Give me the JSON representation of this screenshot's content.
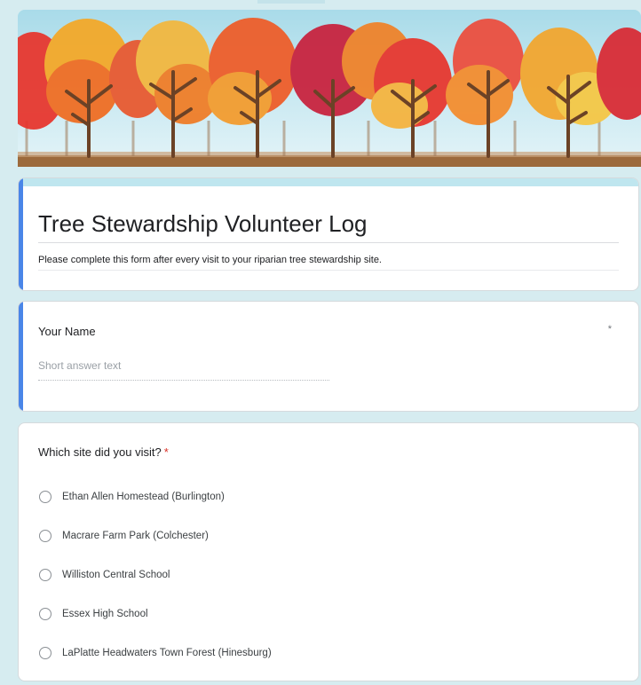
{
  "form": {
    "title": "Tree Stewardship Volunteer Log",
    "description": "Please complete this form after every visit to your riparian tree stewardship site."
  },
  "questions": {
    "name": {
      "label": "Your Name",
      "required_marker": "*",
      "placeholder": "Short answer text"
    },
    "site": {
      "label": "Which site did you visit?",
      "required_marker": "*",
      "options": [
        "Ethan Allen Homestead (Burlington)",
        "Macrare Farm Park (Colchester)",
        "Williston Central School",
        "Essex High School",
        "LaPlatte Headwaters Town Forest (Hinesburg)"
      ]
    }
  },
  "colors": {
    "accent": "#4a86e8",
    "required": "#d93025",
    "page_background": "#d6ecf0",
    "banner_sky": "#bfe6ef"
  }
}
